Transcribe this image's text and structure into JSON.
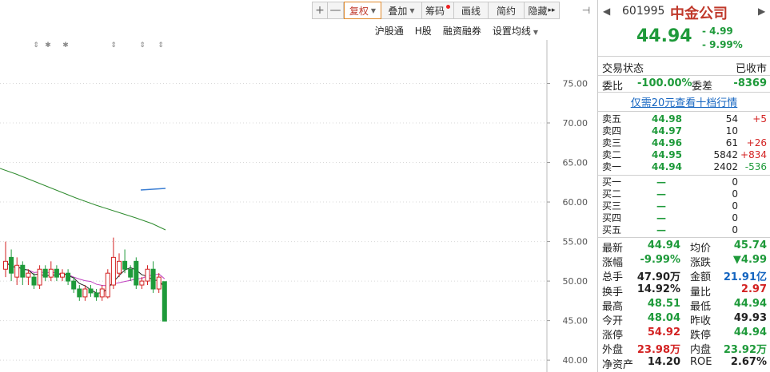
{
  "toolbar": {
    "zoom_in": "+",
    "zoom_out": "—",
    "fuquan": "复权",
    "diejia": "叠加",
    "chouma": "筹码",
    "huaxian": "画线",
    "jianyue": "简约",
    "yincang": "隐藏",
    "more": "▸▸",
    "sidebar_toggle": "⊣"
  },
  "chart_links": [
    "沪股通",
    "H股",
    "融资融券",
    "设置均线"
  ],
  "chart_data": {
    "type": "candlestick",
    "y_ticks": [
      "75.00",
      "70.00",
      "65.00",
      "60.00",
      "55.00",
      "50.00",
      "45.00",
      "40.00"
    ],
    "ylim": [
      38.5,
      80.5
    ],
    "grid": true,
    "markers": [
      "⇕",
      "✱",
      "✱",
      "⇕",
      "⇕",
      "⇕"
    ],
    "candles": [
      {
        "x": 0,
        "o": 51.5,
        "c": 52.5,
        "h": 55.0,
        "l": 50.5
      },
      {
        "x": 1,
        "o": 53.0,
        "c": 51.0,
        "h": 54.0,
        "l": 50.0
      },
      {
        "x": 2,
        "o": 50.5,
        "c": 52.0,
        "h": 53.0,
        "l": 49.5
      },
      {
        "x": 3,
        "o": 52.0,
        "c": 50.5,
        "h": 52.5,
        "l": 49.5
      },
      {
        "x": 4,
        "o": 50.5,
        "c": 51.0,
        "h": 51.5,
        "l": 49.5
      },
      {
        "x": 5,
        "o": 50.5,
        "c": 49.5,
        "h": 51.0,
        "l": 49.0
      },
      {
        "x": 6,
        "o": 49.5,
        "c": 51.5,
        "h": 52.0,
        "l": 49.0
      },
      {
        "x": 7,
        "o": 51.5,
        "c": 50.5,
        "h": 52.0,
        "l": 50.0
      },
      {
        "x": 8,
        "o": 50.5,
        "c": 51.5,
        "h": 52.5,
        "l": 50.0
      },
      {
        "x": 9,
        "o": 51.5,
        "c": 50.5,
        "h": 52.0,
        "l": 50.0
      },
      {
        "x": 10,
        "o": 50.5,
        "c": 51.0,
        "h": 51.5,
        "l": 50.0
      },
      {
        "x": 11,
        "o": 51.0,
        "c": 50.0,
        "h": 51.5,
        "l": 49.5
      },
      {
        "x": 12,
        "o": 50.0,
        "c": 49.0,
        "h": 50.5,
        "l": 48.5
      },
      {
        "x": 13,
        "o": 49.0,
        "c": 48.0,
        "h": 49.5,
        "l": 47.5
      },
      {
        "x": 14,
        "o": 48.0,
        "c": 49.0,
        "h": 49.5,
        "l": 47.5
      },
      {
        "x": 15,
        "o": 49.0,
        "c": 48.5,
        "h": 49.5,
        "l": 48.0
      },
      {
        "x": 16,
        "o": 48.5,
        "c": 48.0,
        "h": 49.0,
        "l": 47.5
      },
      {
        "x": 17,
        "o": 48.0,
        "c": 49.0,
        "h": 49.5,
        "l": 47.5
      },
      {
        "x": 18,
        "o": 48.0,
        "c": 51.0,
        "h": 51.5,
        "l": 47.8
      },
      {
        "x": 19,
        "o": 49.5,
        "c": 53.0,
        "h": 55.5,
        "l": 49.0
      },
      {
        "x": 20,
        "o": 51.0,
        "c": 52.5,
        "h": 53.5,
        "l": 50.5
      },
      {
        "x": 21,
        "o": 52.5,
        "c": 51.5,
        "h": 54.0,
        "l": 51.0
      },
      {
        "x": 22,
        "o": 51.5,
        "c": 50.5,
        "h": 52.0,
        "l": 50.0
      },
      {
        "x": 23,
        "o": 52.5,
        "c": 49.5,
        "h": 53.0,
        "l": 49.0
      },
      {
        "x": 24,
        "o": 49.5,
        "c": 50.0,
        "h": 50.5,
        "l": 49.0
      },
      {
        "x": 25,
        "o": 50.0,
        "c": 51.5,
        "h": 52.0,
        "l": 49.5
      },
      {
        "x": 26,
        "o": 51.5,
        "c": 49.0,
        "h": 52.5,
        "l": 48.5
      },
      {
        "x": 27,
        "o": 49.0,
        "c": 50.5,
        "h": 51.0,
        "l": 48.5
      },
      {
        "x": 28,
        "o": 49.93,
        "c": 44.94,
        "h": 49.5,
        "l": 44.94
      }
    ]
  },
  "quote": {
    "code": "601995",
    "name": "中金公司",
    "price": "44.94",
    "change": "- 4.99",
    "change_pct": "- 9.99%",
    "trade_status_label": "交易状态",
    "trade_status": "已收市",
    "weibi_label": "委比",
    "weibi": "-100.00%",
    "weicha_label": "委差",
    "weicha": "-8369",
    "promo": "仅需20元查看十档行情",
    "asks": [
      {
        "label": "卖五",
        "price": "44.98",
        "vol": "54",
        "chg": "+5"
      },
      {
        "label": "卖四",
        "price": "44.97",
        "vol": "10",
        "chg": ""
      },
      {
        "label": "卖三",
        "price": "44.96",
        "vol": "61",
        "chg": "+26"
      },
      {
        "label": "卖二",
        "price": "44.95",
        "vol": "5842",
        "chg": "+834"
      },
      {
        "label": "卖一",
        "price": "44.94",
        "vol": "2402",
        "chg": "-536"
      }
    ],
    "bids": [
      {
        "label": "买一",
        "price": "—",
        "vol": "0"
      },
      {
        "label": "买二",
        "price": "—",
        "vol": "0"
      },
      {
        "label": "买三",
        "price": "—",
        "vol": "0"
      },
      {
        "label": "买四",
        "price": "—",
        "vol": "0"
      },
      {
        "label": "买五",
        "price": "—",
        "vol": "0"
      }
    ],
    "stats": [
      {
        "l1": "最新",
        "v1": "44.94",
        "c1": "g",
        "l2": "均价",
        "v2": "45.74",
        "c2": "g"
      },
      {
        "l1": "涨幅",
        "v1": "-9.99%",
        "c1": "g",
        "l2": "涨跌",
        "v2": "▼4.99",
        "c2": "g"
      },
      {
        "l1": "总手",
        "v1": "47.90万",
        "c1": "k",
        "l2": "金额",
        "v2": "21.91亿",
        "c2": "b"
      },
      {
        "l1": "换手",
        "v1": "14.92%",
        "c1": "k",
        "l2": "量比",
        "v2": "2.97",
        "c2": "r"
      },
      {
        "l1": "最高",
        "v1": "48.51",
        "c1": "g",
        "l2": "最低",
        "v2": "44.94",
        "c2": "g"
      },
      {
        "l1": "今开",
        "v1": "48.04",
        "c1": "g",
        "l2": "昨收",
        "v2": "49.93",
        "c2": "k"
      },
      {
        "l1": "涨停",
        "v1": "54.92",
        "c1": "r",
        "l2": "跌停",
        "v2": "44.94",
        "c2": "g"
      },
      {
        "l1": "外盘",
        "v1": "23.98万",
        "c1": "r",
        "l2": "内盘",
        "v2": "23.92万",
        "c2": "g"
      },
      {
        "l1": "净资产",
        "v1": "14.20",
        "c1": "k",
        "l2": "ROE",
        "v2": "2.67%",
        "c2": "k"
      }
    ]
  },
  "colors": {
    "up": "#d32222",
    "down": "#1e9a3a",
    "ma_green": "#2e8b2e",
    "ma_black": "#222222",
    "ma_purple": "#c040c0",
    "grid": "#d8d8d8"
  }
}
